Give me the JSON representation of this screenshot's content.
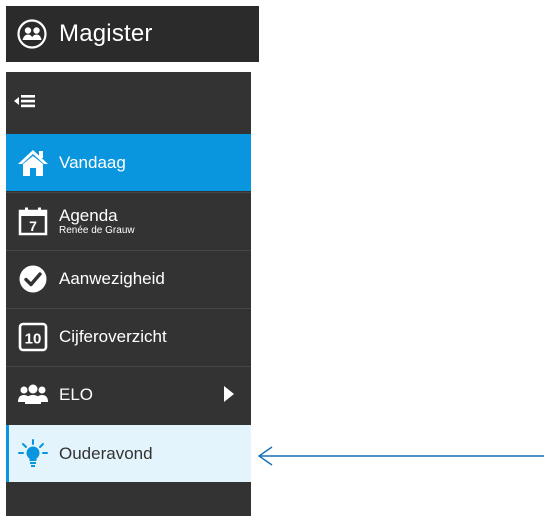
{
  "header": {
    "title": "Magister",
    "logo_icon": "magister-logo-icon"
  },
  "sidebar": {
    "toggle_icon": "collapse-menu-icon",
    "items": [
      {
        "label": "Vandaag",
        "icon": "home-icon",
        "state": "active"
      },
      {
        "label": "Agenda",
        "sublabel": "Renée de Grauw",
        "icon": "calendar-7-icon"
      },
      {
        "label": "Aanwezigheid",
        "icon": "check-circle-icon"
      },
      {
        "label": "Cijferoverzicht",
        "icon": "grade-10-icon"
      },
      {
        "label": "ELO",
        "icon": "users-icon",
        "has_submenu": true
      },
      {
        "label": "Ouderavond",
        "icon": "lightbulb-icon",
        "state": "highlighted"
      }
    ]
  },
  "colors": {
    "active": "#0a96de",
    "sidebar_bg": "#333333",
    "highlight_bg": "#e4f4fc",
    "arrow": "#1a6fb4"
  }
}
